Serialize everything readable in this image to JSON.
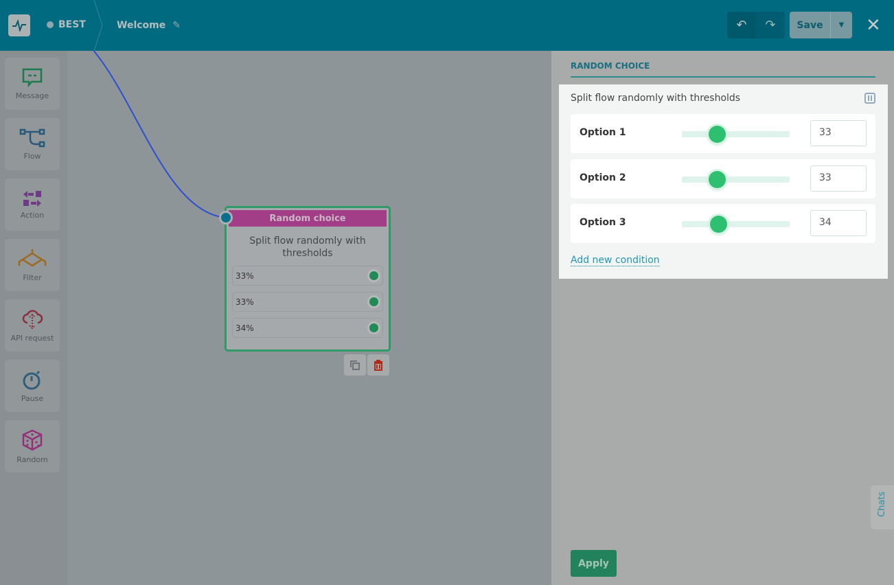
{
  "header": {
    "bot_name": "BEST",
    "flow_title": "Welcome",
    "save_label": "Save"
  },
  "sidebar": {
    "items": [
      {
        "label": "Message"
      },
      {
        "label": "Flow"
      },
      {
        "label": "Action"
      },
      {
        "label": "Filter"
      },
      {
        "label": "API request"
      },
      {
        "label": "Pause"
      },
      {
        "label": "Random"
      }
    ]
  },
  "node": {
    "title": "Random choice",
    "description": "Split flow randomly with thresholds",
    "outputs": [
      "33%",
      "33%",
      "34%"
    ]
  },
  "panel": {
    "title": "RANDOM CHOICE",
    "description": "Split flow randomly with thresholds",
    "options": [
      {
        "label": "Option 1",
        "value": "33",
        "percent": 33
      },
      {
        "label": "Option 2",
        "value": "33",
        "percent": 33
      },
      {
        "label": "Option 3",
        "value": "34",
        "percent": 34
      }
    ],
    "add_label": "Add new condition",
    "apply_label": "Apply"
  },
  "chats_label": "Chats",
  "colors": {
    "header": "#006a80",
    "node_header": "#a23d87",
    "accent": "#2fbf71"
  }
}
